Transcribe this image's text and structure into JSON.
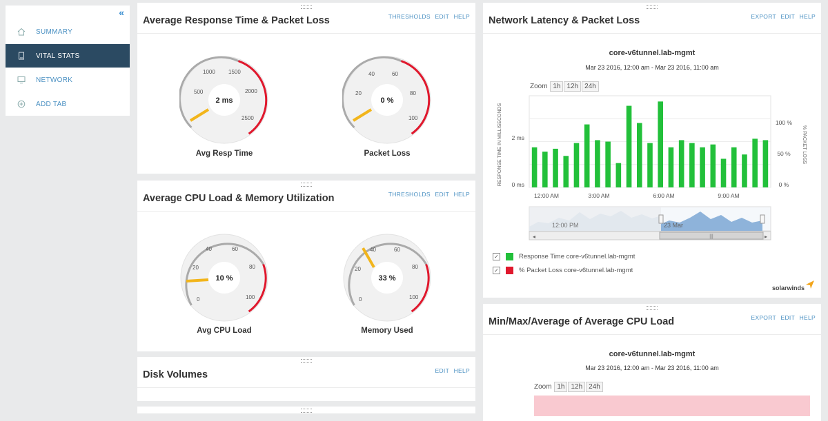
{
  "sidebar": {
    "items": [
      {
        "label": "SUMMARY",
        "icon": "home-icon"
      },
      {
        "label": "VITAL STATS",
        "icon": "device-icon",
        "active": true
      },
      {
        "label": "NETWORK",
        "icon": "monitor-icon"
      },
      {
        "label": "ADD TAB",
        "icon": "add-icon"
      }
    ]
  },
  "panels": {
    "resp": {
      "title": "Average Response Time & Packet Loss",
      "links": [
        "THRESHOLDS",
        "EDIT",
        "HELP"
      ],
      "gauges": [
        {
          "label": "Avg Resp Time",
          "value": "2 ms",
          "ticks": [
            "500",
            "1000",
            "1500",
            "2000",
            "2500"
          ]
        },
        {
          "label": "Packet Loss",
          "value": "0 %",
          "ticks": [
            "20",
            "40",
            "60",
            "80",
            "100"
          ]
        }
      ]
    },
    "cpu": {
      "title": "Average CPU Load & Memory Utilization",
      "links": [
        "THRESHOLDS",
        "EDIT",
        "HELP"
      ],
      "gauges": [
        {
          "label": "Avg CPU Load",
          "value": "10 %",
          "ticks": [
            "0",
            "20",
            "40",
            "60",
            "80",
            "100"
          ]
        },
        {
          "label": "Memory Used",
          "value": "33 %",
          "ticks": [
            "0",
            "20",
            "40",
            "60",
            "80",
            "100"
          ]
        }
      ]
    },
    "disk": {
      "title": "Disk Volumes",
      "links": [
        "EDIT",
        "HELP"
      ]
    },
    "latency": {
      "title": "Network Latency & Packet Loss",
      "links": [
        "EXPORT",
        "EDIT",
        "HELP"
      ],
      "node": "core-v6tunnel.lab-mgmt",
      "range": "Mar 23 2016, 12:00 am - Mar 23 2016, 11:00 am",
      "zoom_label": "Zoom",
      "zoom_buttons": [
        "1h",
        "12h",
        "24h"
      ],
      "legend": [
        {
          "label": "Response Time core-v6tunnel.lab-mgmt",
          "color": "#22c03a"
        },
        {
          "label": "% Packet Loss core-v6tunnel.lab-mgmt",
          "color": "#e0182d"
        }
      ],
      "nav_labels": [
        "12:00 PM",
        "23 Mar"
      ],
      "logo": "solarwinds"
    },
    "minmax": {
      "title": "Min/Max/Average of Average CPU Load",
      "links": [
        "EXPORT",
        "EDIT",
        "HELP"
      ],
      "node": "core-v6tunnel.lab-mgmt",
      "range": "Mar 23 2016, 12:00 am - Mar 23 2016, 11:00 am",
      "zoom_label": "Zoom",
      "zoom_buttons": [
        "1h",
        "12h",
        "24h"
      ]
    }
  },
  "chart_data": {
    "type": "bar",
    "title": "core-v6tunnel.lab-mgmt",
    "subtitle": "Mar 23 2016, 12:00 am - Mar 23 2016, 11:00 am",
    "ylabel": "RESPONSE TIME IN MILLISECONDS",
    "y2label": "% PACKET LOSS",
    "y_ticks": [
      "0 ms",
      "2 ms"
    ],
    "y2_ticks": [
      "0 %",
      "50 %",
      "100 %"
    ],
    "x_ticks": [
      "12:00 AM",
      "3:00 AM",
      "6:00 AM",
      "9:00 AM"
    ],
    "ylim": [
      0,
      3.2
    ],
    "series": [
      {
        "name": "Response Time core-v6tunnel.lab-mgmt",
        "color": "#22c03a",
        "values": [
          1.4,
          1.25,
          1.35,
          1.1,
          1.55,
          2.2,
          1.65,
          1.6,
          0.85,
          2.85,
          2.25,
          1.55,
          3.0,
          1.4,
          1.65,
          1.55,
          1.4,
          1.5,
          1.0,
          1.4,
          1.15,
          1.7,
          1.65
        ]
      },
      {
        "name": "% Packet Loss core-v6tunnel.lab-mgmt",
        "color": "#e0182d",
        "values": [
          0,
          0,
          0,
          0,
          0,
          0,
          0,
          0,
          0,
          0,
          0,
          0,
          0,
          0,
          0,
          0,
          0,
          0,
          0,
          0,
          0,
          0,
          0
        ]
      }
    ],
    "grid": true
  },
  "colors": {
    "accent": "#4a90c2",
    "nav_active": "#2b4a62",
    "threshold_red": "#e0182d",
    "needle": "#f2b51b"
  }
}
